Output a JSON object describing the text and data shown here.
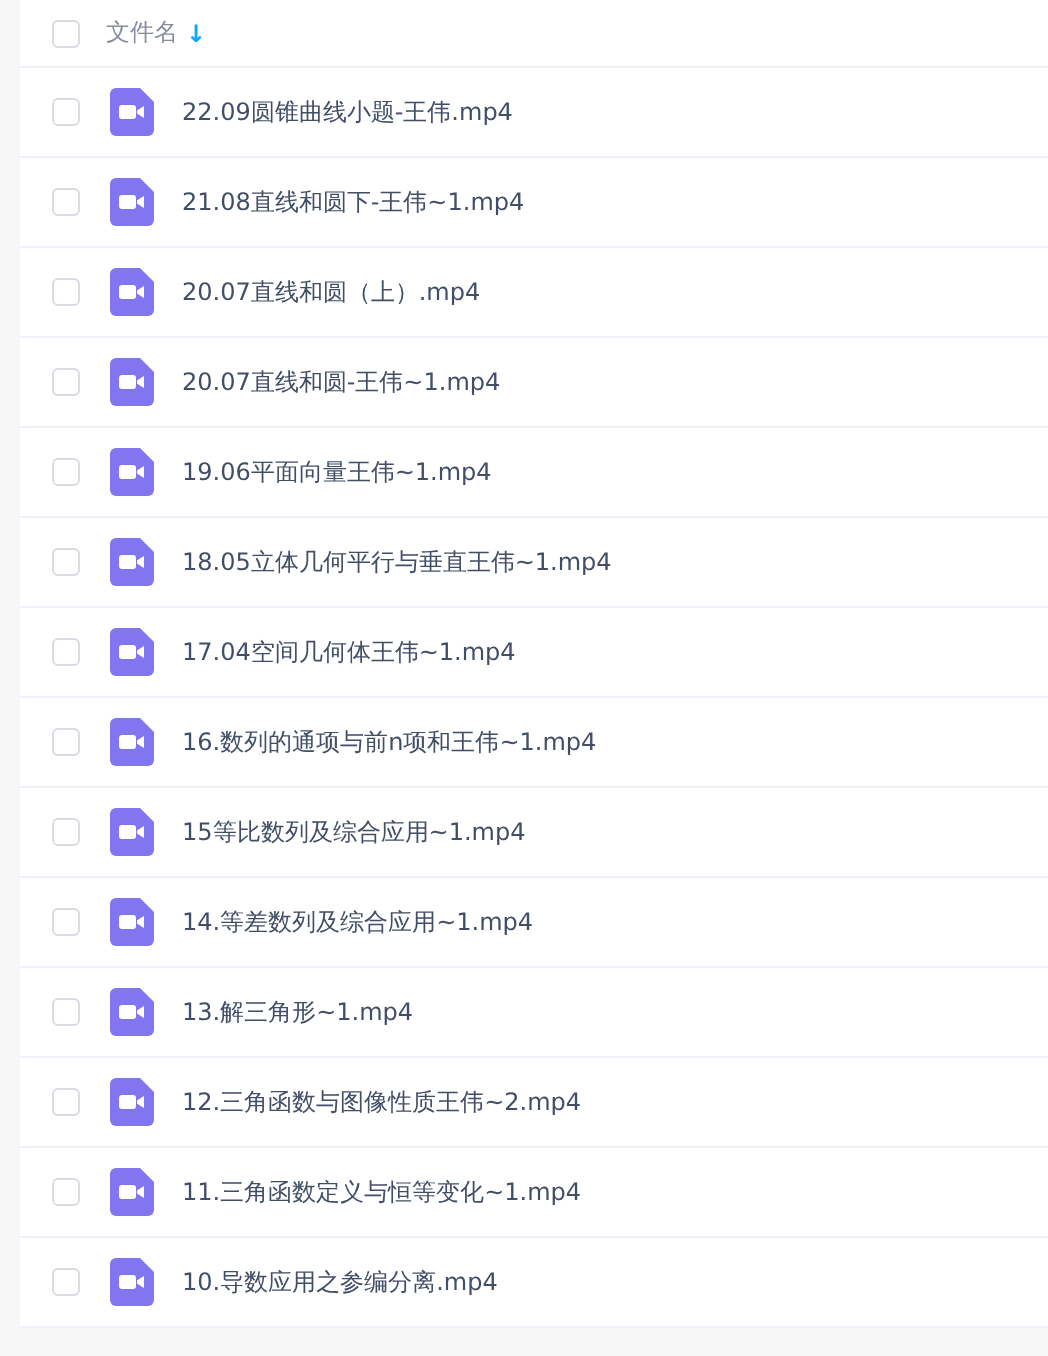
{
  "header": {
    "checked": false,
    "label": "文件名",
    "sort_icon": "↓"
  },
  "files": [
    {
      "name": "22.09圆锥曲线小题-王伟.mp4",
      "checked": false
    },
    {
      "name": "21.08直线和圆下-王伟~1.mp4",
      "checked": false
    },
    {
      "name": "20.07直线和圆（上）.mp4",
      "checked": false
    },
    {
      "name": "20.07直线和圆-王伟~1.mp4",
      "checked": false
    },
    {
      "name": "19.06平面向量王伟~1.mp4",
      "checked": false
    },
    {
      "name": "18.05立体几何平行与垂直王伟~1.mp4",
      "checked": false
    },
    {
      "name": "17.04空间几何体王伟~1.mp4",
      "checked": false
    },
    {
      "name": "16.数列的通项与前n项和王伟~1.mp4",
      "checked": false
    },
    {
      "name": "15等比数列及综合应用~1.mp4",
      "checked": false
    },
    {
      "name": "14.等差数列及综合应用~1.mp4",
      "checked": false
    },
    {
      "name": "13.解三角形~1.mp4",
      "checked": false
    },
    {
      "name": "12.三角函数与图像性质王伟~2.mp4",
      "checked": false
    },
    {
      "name": "11.三角函数定义与恒等变化~1.mp4",
      "checked": false
    },
    {
      "name": "10.导数应用之参编分离.mp4",
      "checked": false
    }
  ]
}
